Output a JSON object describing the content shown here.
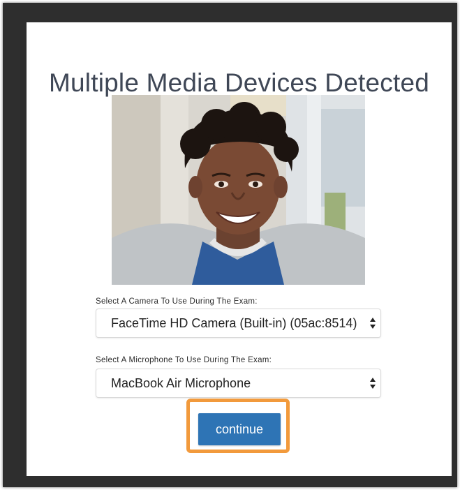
{
  "dialog": {
    "title": "Multiple Media Devices Detected"
  },
  "preview": {
    "icon": "webcam-preview-person"
  },
  "camera": {
    "label": "Select A Camera To Use During The Exam:",
    "value": "FaceTime HD Camera (Built-in) (05ac:8514)"
  },
  "microphone": {
    "label": "Select A Microphone To Use During The Exam:",
    "value": "MacBook Air Microphone"
  },
  "actions": {
    "continue_label": "continue"
  },
  "colors": {
    "frame": "#2e2e2e",
    "title": "#3f4756",
    "button": "#2e74b5",
    "highlight": "#f29a3c"
  }
}
